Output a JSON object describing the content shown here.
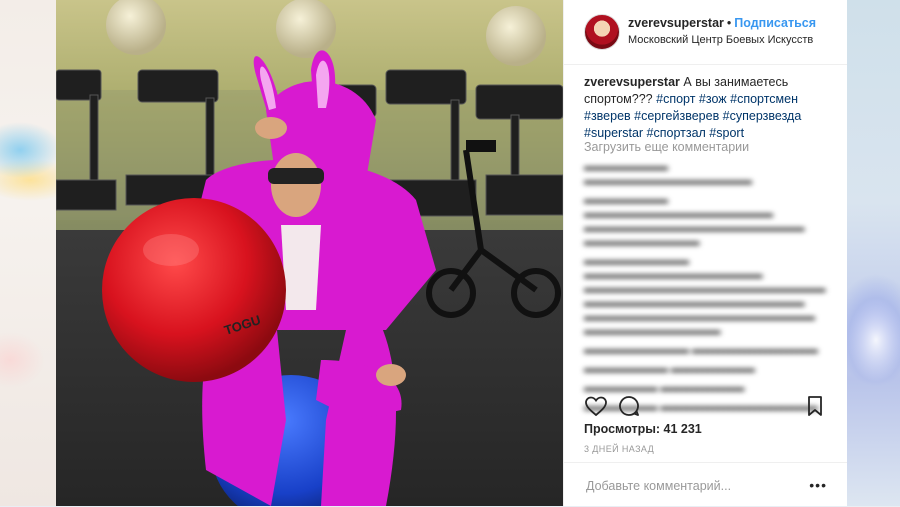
{
  "post": {
    "username": "zverevsuperstar",
    "separator": "•",
    "follow_label": "Подписаться",
    "location": "Московский Центр Боевых Искусств",
    "caption_text": "А вы занимаетесь спортом???",
    "caption_tags": "#спорт #зож #спортсмен #зверев #сергейзверев #суперзвезда #superstar #спортзал #sport",
    "load_more_label": "Загрузить еще комментарии",
    "views_label": "Просмотры:",
    "views_count": "41 231",
    "date_label": "3 ДНЕЙ НАЗАД",
    "add_comment_placeholder": "Добавьте комментарий...",
    "more_label": "•••"
  },
  "icons": {
    "like": "heart-icon",
    "comment": "comment-icon",
    "save": "bookmark-icon",
    "more": "more-options-icon"
  },
  "photo": {
    "ball_brand": "TOGU"
  },
  "colors": {
    "link_blue": "#3897f0",
    "hashtag": "#003569",
    "muted": "#999999",
    "text": "#262626"
  }
}
